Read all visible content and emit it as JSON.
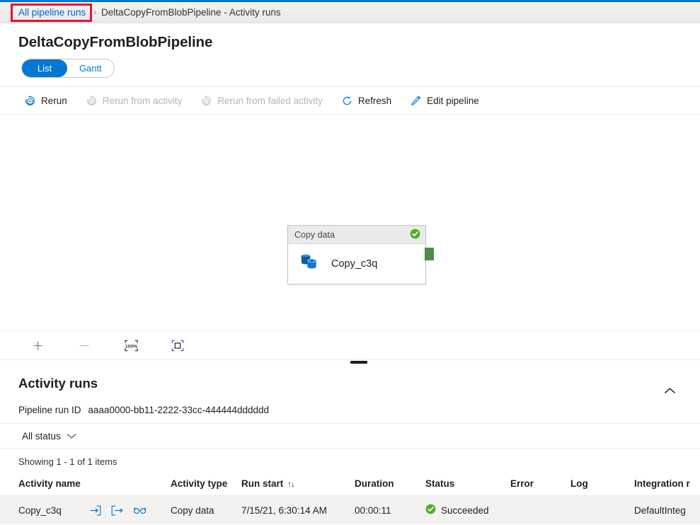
{
  "breadcrumb": {
    "link": "All pipeline runs",
    "separator": "›",
    "current": "DeltaCopyFromBlobPipeline - Activity runs"
  },
  "page": {
    "title": "DeltaCopyFromBlobPipeline"
  },
  "view_toggle": {
    "list": "List",
    "gantt": "Gantt",
    "selected": "List"
  },
  "toolbar": {
    "rerun": "Rerun",
    "rerun_from_activity": "Rerun from activity",
    "rerun_from_failed_activity": "Rerun from failed activity",
    "refresh": "Refresh",
    "edit_pipeline": "Edit pipeline"
  },
  "canvas": {
    "node": {
      "header": "Copy data",
      "name": "Copy_c3q",
      "status": "succeeded"
    }
  },
  "zoom_controls": {
    "zoom_in": "+",
    "zoom_out": "—",
    "zoom_level": "100%",
    "fit_to_screen": "fit"
  },
  "activity_runs": {
    "title": "Activity runs",
    "run_id_label": "Pipeline run ID",
    "run_id_value": "aaaa0000-bb11-2222-33cc-444444dddddd",
    "status_filter": "All status",
    "showing": "Showing 1 - 1 of 1 items",
    "columns": [
      "Activity name",
      "Activity type",
      "Run start",
      "Duration",
      "Status",
      "Error",
      "Log",
      "Integration r"
    ],
    "sort_indicator": "↑↓",
    "rows": [
      {
        "activity_name": "Copy_c3q",
        "activity_type": "Copy data",
        "run_start": "7/15/21, 6:30:14 AM",
        "duration": "00:00:11",
        "status": "Succeeded",
        "error": "",
        "log": "",
        "integration_runtime": "DefaultInteg"
      }
    ]
  },
  "colors": {
    "accent": "#0078d4",
    "highlight": "#e8112d",
    "success": "#4caf27",
    "port": "#4e8c4a"
  }
}
